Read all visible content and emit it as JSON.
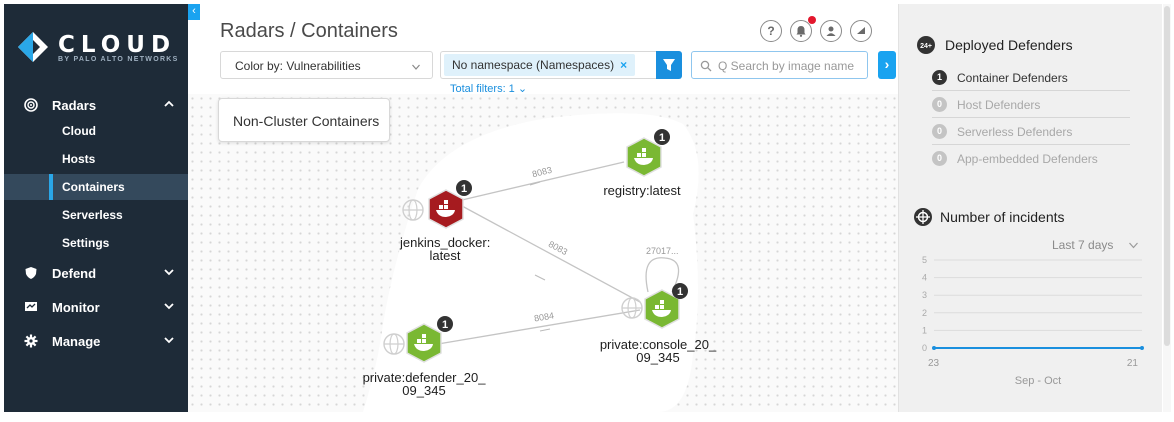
{
  "brand": {
    "title": "CLOUD",
    "subtitle": "BY PALO ALTO NETWORKS"
  },
  "sidebar": {
    "items": [
      {
        "label": "Radars",
        "icon": "radar-icon",
        "expanded": true
      },
      {
        "label": "Defend",
        "icon": "shield-icon",
        "expanded": false
      },
      {
        "label": "Monitor",
        "icon": "monitor-icon",
        "expanded": false
      },
      {
        "label": "Manage",
        "icon": "gear-icon",
        "expanded": false
      }
    ],
    "sub_items": [
      {
        "label": "Cloud"
      },
      {
        "label": "Hosts"
      },
      {
        "label": "Containers",
        "active": true
      },
      {
        "label": "Serverless"
      },
      {
        "label": "Settings"
      }
    ]
  },
  "header": {
    "title": "Radars / Containers",
    "icons": [
      "help-icon",
      "notifications-icon",
      "user-icon",
      "speed-icon"
    ]
  },
  "toolbar": {
    "color_by": "Color by: Vulnerabilities",
    "filter_chip": "No namespace (Namespaces)",
    "search_placeholder": "Q Search by image name",
    "total_filters": "Total filters: 1"
  },
  "graph": {
    "group_label": "Non-Cluster Containers",
    "nodes": [
      {
        "label_line1": "jenkins_docker:",
        "label_line2": "latest",
        "badge": "1",
        "status": "critical"
      },
      {
        "label_line1": "registry:latest",
        "label_line2": "",
        "badge": "1",
        "status": "ok"
      },
      {
        "label_line1": "private:console_20_",
        "label_line2": "09_345",
        "badge": "1",
        "status": "ok"
      },
      {
        "label_line1": "private:defender_20_",
        "label_line2": "09_345",
        "badge": "1",
        "status": "ok"
      }
    ],
    "edges": [
      {
        "from": "jenkins_docker:latest",
        "to": "registry:latest",
        "port": "8083"
      },
      {
        "from": "jenkins_docker:latest",
        "to": "private:console_20_09_345",
        "port": "8083"
      },
      {
        "from": "private:defender_20_09_345",
        "to": "private:console_20_09_345",
        "port": "8084"
      },
      {
        "from": "private:console_20_09_345",
        "to": "private:console_20_09_345",
        "port": "27017..."
      }
    ]
  },
  "right_panel": {
    "defenders_title": "Deployed Defenders",
    "defenders_icon_text": "24+",
    "defenders": [
      {
        "count": "1",
        "label": "Container Defenders",
        "active": true
      },
      {
        "count": "0",
        "label": "Host Defenders",
        "active": false
      },
      {
        "count": "0",
        "label": "Serverless Defenders",
        "active": false
      },
      {
        "count": "0",
        "label": "App-embedded Defenders",
        "active": false
      }
    ],
    "incidents_title": "Number of incidents",
    "period": "Last 7 days",
    "chart_data": {
      "type": "line",
      "x": [
        "23",
        "21"
      ],
      "values": [
        0,
        0
      ],
      "xlabel": "Sep - Oct",
      "ylim": [
        0,
        5
      ],
      "yticks": [
        "0",
        "1",
        "2",
        "3",
        "4",
        "5"
      ]
    }
  },
  "colors": {
    "sidebar_bg": "#1e2b38",
    "accent": "#1aa3f0",
    "critical": "#a61b1f",
    "ok": "#7ab833",
    "badge": "#333333",
    "chart_line": "#1a8fde"
  }
}
